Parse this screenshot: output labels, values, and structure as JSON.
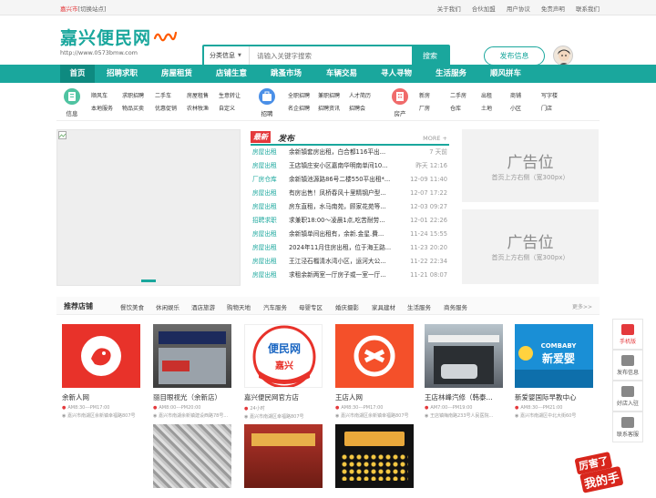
{
  "topbar": {
    "city": "嘉兴市",
    "switch": "[切换站点]",
    "links": [
      "关于我们",
      "合伙加盟",
      "用户协议",
      "免责声明",
      "联系我们"
    ]
  },
  "logo": {
    "title": "嘉兴便民网",
    "url": "http://www.0573bmw.com"
  },
  "search": {
    "category": "分类信息",
    "placeholder": "请输入关键字搜索",
    "button": "搜索"
  },
  "post_button": "发布信息",
  "nav": [
    "首页",
    "招聘求职",
    "房屋租赁",
    "店铺生意",
    "跳蚤市场",
    "车辆交易",
    "寻人寻物",
    "生活服务",
    "顺风拼车"
  ],
  "category_groups": [
    {
      "label": "信息",
      "color": "#4fc3a1",
      "subs": [
        [
          "顺风车",
          "求职招聘",
          "二手车",
          "房屋租售",
          "生意转让"
        ],
        [
          "本地服务",
          "物品买卖",
          "优惠促销",
          "农林牧渔",
          "自定义"
        ]
      ]
    },
    {
      "label": "招聘",
      "color": "#4a8fe7",
      "subs": [
        [
          "全职招聘",
          "兼职招聘",
          "人才简历"
        ],
        [
          "名企招聘",
          "招聘资讯",
          "招聘会"
        ]
      ]
    },
    {
      "label": "房产",
      "color": "#f06b6b",
      "subs": [
        [
          "新房",
          "二手房",
          "出租",
          "商铺",
          "写字楼"
        ],
        [
          "厂房",
          "仓库",
          "土地",
          "小区",
          "门店"
        ]
      ]
    }
  ],
  "latest": {
    "tag": "最新",
    "title": "发布",
    "more": "MORE +",
    "rows": [
      {
        "cat": "房屋出租",
        "text": "余新镇套房出租，白合都116平出...",
        "date": "7 天前"
      },
      {
        "cat": "房屋出租",
        "text": "王店镇庄安小区嘉南华明南单间10...",
        "date": "昨天 12:16"
      },
      {
        "cat": "厂房仓库",
        "text": "余新镇池源路86号二楼550平出租*...",
        "date": "12-09 11:40"
      },
      {
        "cat": "房屋出租",
        "text": "有房出售！凤桥春风十里精钢户型...",
        "date": "12-07 17:22"
      },
      {
        "cat": "房屋出租",
        "text": "房东直租，水马南苑，顾家花苑等...",
        "date": "12-03 09:27"
      },
      {
        "cat": "招聘求职",
        "text": "求兼职18:00～凌晨1点,吃苦耐劳...",
        "date": "12-01 22:26"
      },
      {
        "cat": "房屋出租",
        "text": "余新镇单间出租有，余新.金星.費...",
        "date": "11-24 15:55"
      },
      {
        "cat": "房屋出租",
        "text": "2024年11月住房出租，位于海王路...",
        "date": "11-23 20:20"
      },
      {
        "cat": "房屋出租",
        "text": "王江泾石榴清水湾小区，运河大公...",
        "date": "11-22 22:34"
      },
      {
        "cat": "房屋出租",
        "text": "求租余新两室一厅房子或一室一厅...",
        "date": "11-21 08:07"
      }
    ]
  },
  "ads": [
    {
      "title": "广告位",
      "desc": "首页上方右侧（宽300px）"
    },
    {
      "title": "广告位",
      "desc": "首页上方右侧（宽300px）"
    }
  ],
  "stores": {
    "title": "推荐店铺",
    "tabs": [
      "餐饮美食",
      "休闲娱乐",
      "酒店旅游",
      "购物天地",
      "汽车服务",
      "母婴专区",
      "婚庆摄影",
      "家具建材",
      "生活服务",
      "商务服务"
    ],
    "more": "更多>>",
    "cards": [
      {
        "name": "余新人网",
        "hours": "AM8:30---PM17:00",
        "addr": "嘉兴市南湖区余新镇幸福路807号"
      },
      {
        "name": "丽目眼视光（余新店）",
        "hours": "AM8:00---PM20:00",
        "addr": "嘉兴市南湖余新镇建设西路78号..."
      },
      {
        "name": "嘉兴便民网官方店",
        "hours": "24小时",
        "addr": "嘉兴市南湖区幸福路807号"
      },
      {
        "name": "王店人网",
        "hours": "AM8:30---PM17:00",
        "addr": "嘉兴市南湖区余新镇幸福路807号"
      },
      {
        "name": "王店林峰汽修（韩泰...",
        "hours": "AM7:00---PM19:00",
        "addr": "王店镇梅南路233号人民医院..."
      },
      {
        "name": "新爱婴国际早教中心",
        "hours": "AM8:30---PM21:00",
        "addr": "嘉兴市南湖区中北大街60号"
      }
    ]
  },
  "sidebar": [
    "手机版",
    "发布信息",
    "好店入驻",
    "联系客服"
  ],
  "promo": {
    "line1": "厉害了",
    "line2": "我的手"
  }
}
